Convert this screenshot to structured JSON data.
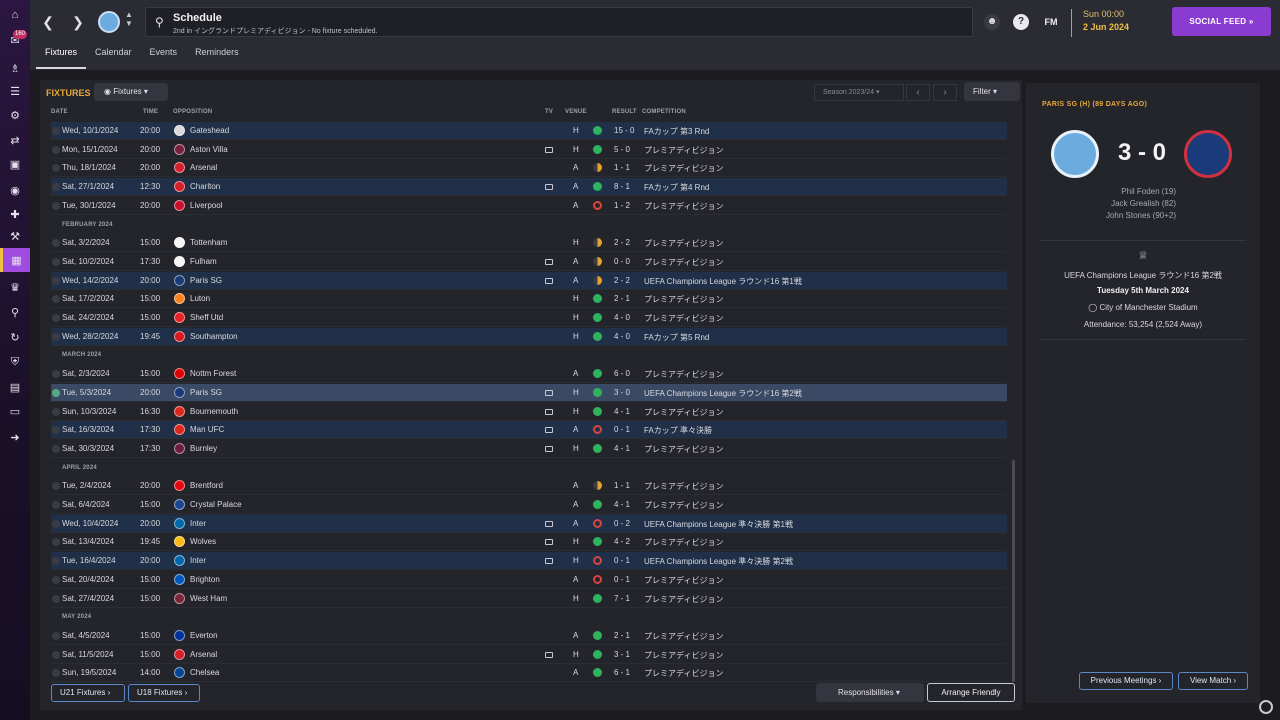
{
  "nav": {
    "badge": "160",
    "icons": [
      "home-icon",
      "inbox-icon",
      "squad-icon",
      "clipboard-icon",
      "training-icon",
      "dynamics-icon",
      "transfers-icon",
      "scouting-icon",
      "medical-icon",
      "data-hub-icon",
      "schedule-icon",
      "trophy-icon",
      "search-icon",
      "refresh-icon",
      "club-shield-icon",
      "briefcase-icon",
      "finance-icon",
      "exit-icon"
    ]
  },
  "topbar": {
    "title": "Schedule",
    "subtitle": "2nd in イングランドプレミアディビジョン - No fixture scheduled.",
    "fm_label": "FM",
    "time": "Sun 00:00",
    "date": "2 Jun 2024",
    "social_feed": "SOCIAL FEED",
    "tabs": [
      "Fixtures",
      "Calendar",
      "Events",
      "Reminders"
    ]
  },
  "fixtures_panel": {
    "title": "FIXTURES",
    "view_dropdown": "Fixtures",
    "season": "Season 2023/24",
    "filter": "Filter",
    "columns": {
      "date": "DATE",
      "time": "TIME",
      "opposition": "OPPOSITION",
      "tv": "TV",
      "venue": "VENUE",
      "result": "RESULT",
      "competition": "COMPETITION"
    },
    "months": [
      "FEBRUARY 2024",
      "MARCH 2024",
      "APRIL 2024",
      "MAY 2024"
    ],
    "rows": [
      {
        "date": "Wed, 10/1/2024",
        "time": "20:00",
        "opp": "Gateshead",
        "tv": false,
        "venue": "H",
        "result": "win",
        "score": "15 - 0",
        "comp": "FAカップ 第3 Rnd",
        "cup": true,
        "crest": "#d9d9d9"
      },
      {
        "date": "Mon, 15/1/2024",
        "time": "20:00",
        "opp": "Aston Villa",
        "tv": true,
        "venue": "H",
        "result": "win",
        "score": "5 - 0",
        "comp": "プレミアディビジョン",
        "cup": false,
        "crest": "#7a1f3d"
      },
      {
        "date": "Thu, 18/1/2024",
        "time": "20:00",
        "opp": "Arsenal",
        "tv": false,
        "venue": "A",
        "result": "draw",
        "score": "1 - 1",
        "comp": "プレミアディビジョン",
        "cup": false,
        "crest": "#d4202a"
      },
      {
        "date": "Sat, 27/1/2024",
        "time": "12:30",
        "opp": "Charlton",
        "tv": true,
        "venue": "A",
        "result": "win",
        "score": "8 - 1",
        "comp": "FAカップ 第4 Rnd",
        "cup": true,
        "crest": "#d4202a"
      },
      {
        "date": "Tue, 30/1/2024",
        "time": "20:00",
        "opp": "Liverpool",
        "tv": false,
        "venue": "A",
        "result": "loss",
        "score": "1 - 2",
        "comp": "プレミアディビジョン",
        "cup": false,
        "crest": "#c8102e"
      },
      {
        "date": "Sat, 3/2/2024",
        "time": "15:00",
        "opp": "Tottenham",
        "tv": false,
        "venue": "H",
        "result": "draw",
        "score": "2 - 2",
        "comp": "プレミアディビジョン",
        "cup": false,
        "crest": "#f4f4f4"
      },
      {
        "date": "Sat, 10/2/2024",
        "time": "17:30",
        "opp": "Fulham",
        "tv": true,
        "venue": "A",
        "result": "draw",
        "score": "0 - 0",
        "comp": "プレミアディビジョン",
        "cup": false,
        "crest": "#f4f4f4"
      },
      {
        "date": "Wed, 14/2/2024",
        "time": "20:00",
        "opp": "Paris SG",
        "tv": true,
        "venue": "A",
        "result": "draw",
        "score": "2 - 2",
        "comp": "UEFA Champions League ラウンド16 第1戦",
        "cup": true,
        "crest": "#1a3a7a"
      },
      {
        "date": "Sat, 17/2/2024",
        "time": "15:00",
        "opp": "Luton",
        "tv": false,
        "venue": "H",
        "result": "win",
        "score": "2 - 1",
        "comp": "プレミアディビジョン",
        "cup": false,
        "crest": "#f58220"
      },
      {
        "date": "Sat, 24/2/2024",
        "time": "15:00",
        "opp": "Sheff Utd",
        "tv": false,
        "venue": "H",
        "result": "win",
        "score": "4 - 0",
        "comp": "プレミアディビジョン",
        "cup": false,
        "crest": "#e42227"
      },
      {
        "date": "Wed, 28/2/2024",
        "time": "19:45",
        "opp": "Southampton",
        "tv": false,
        "venue": "H",
        "result": "win",
        "score": "4 - 0",
        "comp": "FAカップ 第5 Rnd",
        "cup": true,
        "crest": "#d71920"
      },
      {
        "date": "Sat, 2/3/2024",
        "time": "15:00",
        "opp": "Nottm Forest",
        "tv": false,
        "venue": "A",
        "result": "win",
        "score": "6 - 0",
        "comp": "プレミアディビジョン",
        "cup": false,
        "crest": "#dd0000"
      },
      {
        "date": "Tue, 5/3/2024",
        "time": "20:00",
        "opp": "Paris SG",
        "tv": true,
        "venue": "H",
        "result": "win",
        "score": "3 - 0",
        "comp": "UEFA Champions League ラウンド16 第2戦",
        "cup": true,
        "selected": true,
        "crest": "#1a3a7a"
      },
      {
        "date": "Sun, 10/3/2024",
        "time": "16:30",
        "opp": "Bournemouth",
        "tv": true,
        "venue": "H",
        "result": "win",
        "score": "4 - 1",
        "comp": "プレミアディビジョン",
        "cup": false,
        "crest": "#da291c"
      },
      {
        "date": "Sat, 16/3/2024",
        "time": "17:30",
        "opp": "Man UFC",
        "tv": true,
        "venue": "A",
        "result": "loss",
        "score": "0 - 1",
        "comp": "FAカップ 準々決勝",
        "cup": true,
        "crest": "#da291c"
      },
      {
        "date": "Sat, 30/3/2024",
        "time": "17:30",
        "opp": "Burnley",
        "tv": true,
        "venue": "H",
        "result": "win",
        "score": "4 - 1",
        "comp": "プレミアディビジョン",
        "cup": false,
        "crest": "#6c1d45"
      },
      {
        "date": "Tue, 2/4/2024",
        "time": "20:00",
        "opp": "Brentford",
        "tv": false,
        "venue": "A",
        "result": "draw",
        "score": "1 - 1",
        "comp": "プレミアディビジョン",
        "cup": false,
        "crest": "#e30613"
      },
      {
        "date": "Sat, 6/4/2024",
        "time": "15:00",
        "opp": "Crystal Palace",
        "tv": false,
        "venue": "A",
        "result": "win",
        "score": "4 - 1",
        "comp": "プレミアディビジョン",
        "cup": false,
        "crest": "#1b458f"
      },
      {
        "date": "Wed, 10/4/2024",
        "time": "20:00",
        "opp": "Inter",
        "tv": true,
        "venue": "A",
        "result": "loss",
        "score": "0 - 2",
        "comp": "UEFA Champions League 準々決勝 第1戦",
        "cup": true,
        "crest": "#0068a8"
      },
      {
        "date": "Sat, 13/4/2024",
        "time": "19:45",
        "opp": "Wolves",
        "tv": true,
        "venue": "H",
        "result": "win",
        "score": "4 - 2",
        "comp": "プレミアディビジョン",
        "cup": false,
        "crest": "#fdb913"
      },
      {
        "date": "Tue, 16/4/2024",
        "time": "20:00",
        "opp": "Inter",
        "tv": true,
        "venue": "H",
        "result": "loss",
        "score": "0 - 1",
        "comp": "UEFA Champions League 準々決勝 第2戦",
        "cup": true,
        "crest": "#0068a8"
      },
      {
        "date": "Sat, 20/4/2024",
        "time": "15:00",
        "opp": "Brighton",
        "tv": false,
        "venue": "A",
        "result": "loss",
        "score": "0 - 1",
        "comp": "プレミアディビジョン",
        "cup": false,
        "crest": "#0057b8"
      },
      {
        "date": "Sat, 27/4/2024",
        "time": "15:00",
        "opp": "West Ham",
        "tv": false,
        "venue": "H",
        "result": "win",
        "score": "7 - 1",
        "comp": "プレミアディビジョン",
        "cup": false,
        "crest": "#7a263a"
      },
      {
        "date": "Sat, 4/5/2024",
        "time": "15:00",
        "opp": "Everton",
        "tv": false,
        "venue": "A",
        "result": "win",
        "score": "2 - 1",
        "comp": "プレミアディビジョン",
        "cup": false,
        "crest": "#003399"
      },
      {
        "date": "Sat, 11/5/2024",
        "time": "15:00",
        "opp": "Arsenal",
        "tv": true,
        "venue": "H",
        "result": "win",
        "score": "3 - 1",
        "comp": "プレミアディビジョン",
        "cup": false,
        "crest": "#d4202a"
      },
      {
        "date": "Sun, 19/5/2024",
        "time": "14:00",
        "opp": "Chelsea",
        "tv": false,
        "venue": "A",
        "result": "win",
        "score": "6 - 1",
        "comp": "プレミアディビジョン",
        "cup": false,
        "crest": "#034694"
      }
    ],
    "u21_button": "U21 Fixtures",
    "u18_button": "U18 Fixtures",
    "responsibilities": "Responsibilities",
    "arrange_friendly": "Arrange Friendly"
  },
  "result_colors": {
    "win": "#2fb35f",
    "draw": "#e8a12a",
    "loss": "#d9453e"
  },
  "match_panel": {
    "header": "PARIS SG (H) (89 DAYS AGO)",
    "score": "3 - 0",
    "scorers": [
      "Phil Foden (19)",
      "Jack Grealish (82)",
      "John Stones (90+2)"
    ],
    "competition": "UEFA Champions League ラウンド16 第2戦",
    "date": "Tuesday 5th March 2024",
    "stadium": "City of Manchester Stadium",
    "attendance": "Attendance: 53,254 (2,524 Away)",
    "previous_meetings": "Previous Meetings",
    "view_match": "View Match"
  }
}
